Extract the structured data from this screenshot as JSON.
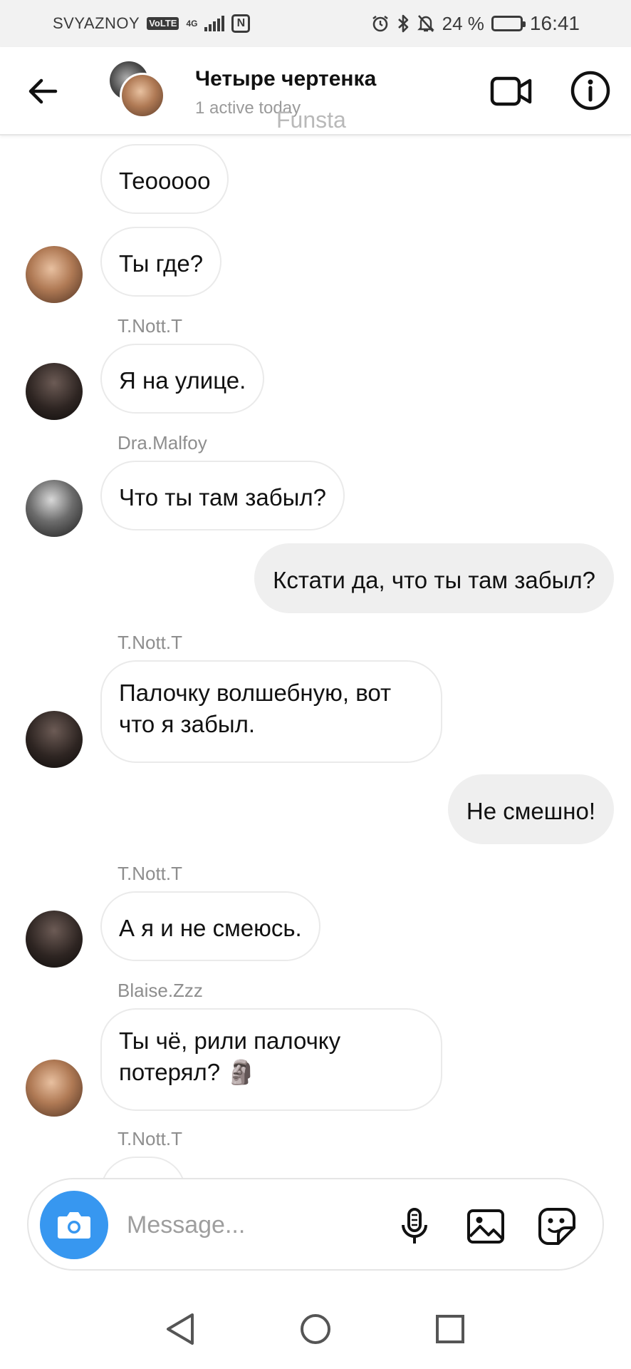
{
  "status_bar": {
    "carrier": "SVYAZNOY",
    "volte": "VoLTE",
    "network": "4G",
    "nfc": "N",
    "battery": "24 %",
    "battery_level": 0.24,
    "time": "16:41"
  },
  "header": {
    "title": "Четыре чертенка",
    "subtitle": "1 active today",
    "watermark": "Funsta"
  },
  "messages": [
    {
      "text": "Теооооо"
    },
    {
      "text": "Ты где?"
    },
    {
      "sender": "T.Nott.T",
      "text": "Я на улице."
    },
    {
      "sender": "Dra.Malfoy",
      "text": "Что ты там забыл?"
    },
    {
      "text": "Кстати да, что ты там забыл?"
    },
    {
      "sender": "T.Nott.T",
      "text": "Палочку волшебную, вот что я забыл."
    },
    {
      "text": "Не смешно!"
    },
    {
      "sender": "T.Nott.T",
      "text": "А я и не смеюсь."
    },
    {
      "sender": "Blaise.Zzz",
      "text": "Ты чё, рили палочку потерял? 🗿"
    },
    {
      "sender": "T.Nott.T"
    }
  ],
  "composer": {
    "placeholder": "Message..."
  },
  "icons": {
    "back": "arrow-left-icon",
    "video": "video-camera-icon",
    "info": "info-icon",
    "camera": "camera-icon",
    "mic": "microphone-icon",
    "gallery": "gallery-icon",
    "sticker": "sticker-icon"
  },
  "colors": {
    "accent": "#3797f0",
    "outgoing_bubble": "#efefef",
    "sender_name": "#8e8e8e"
  }
}
